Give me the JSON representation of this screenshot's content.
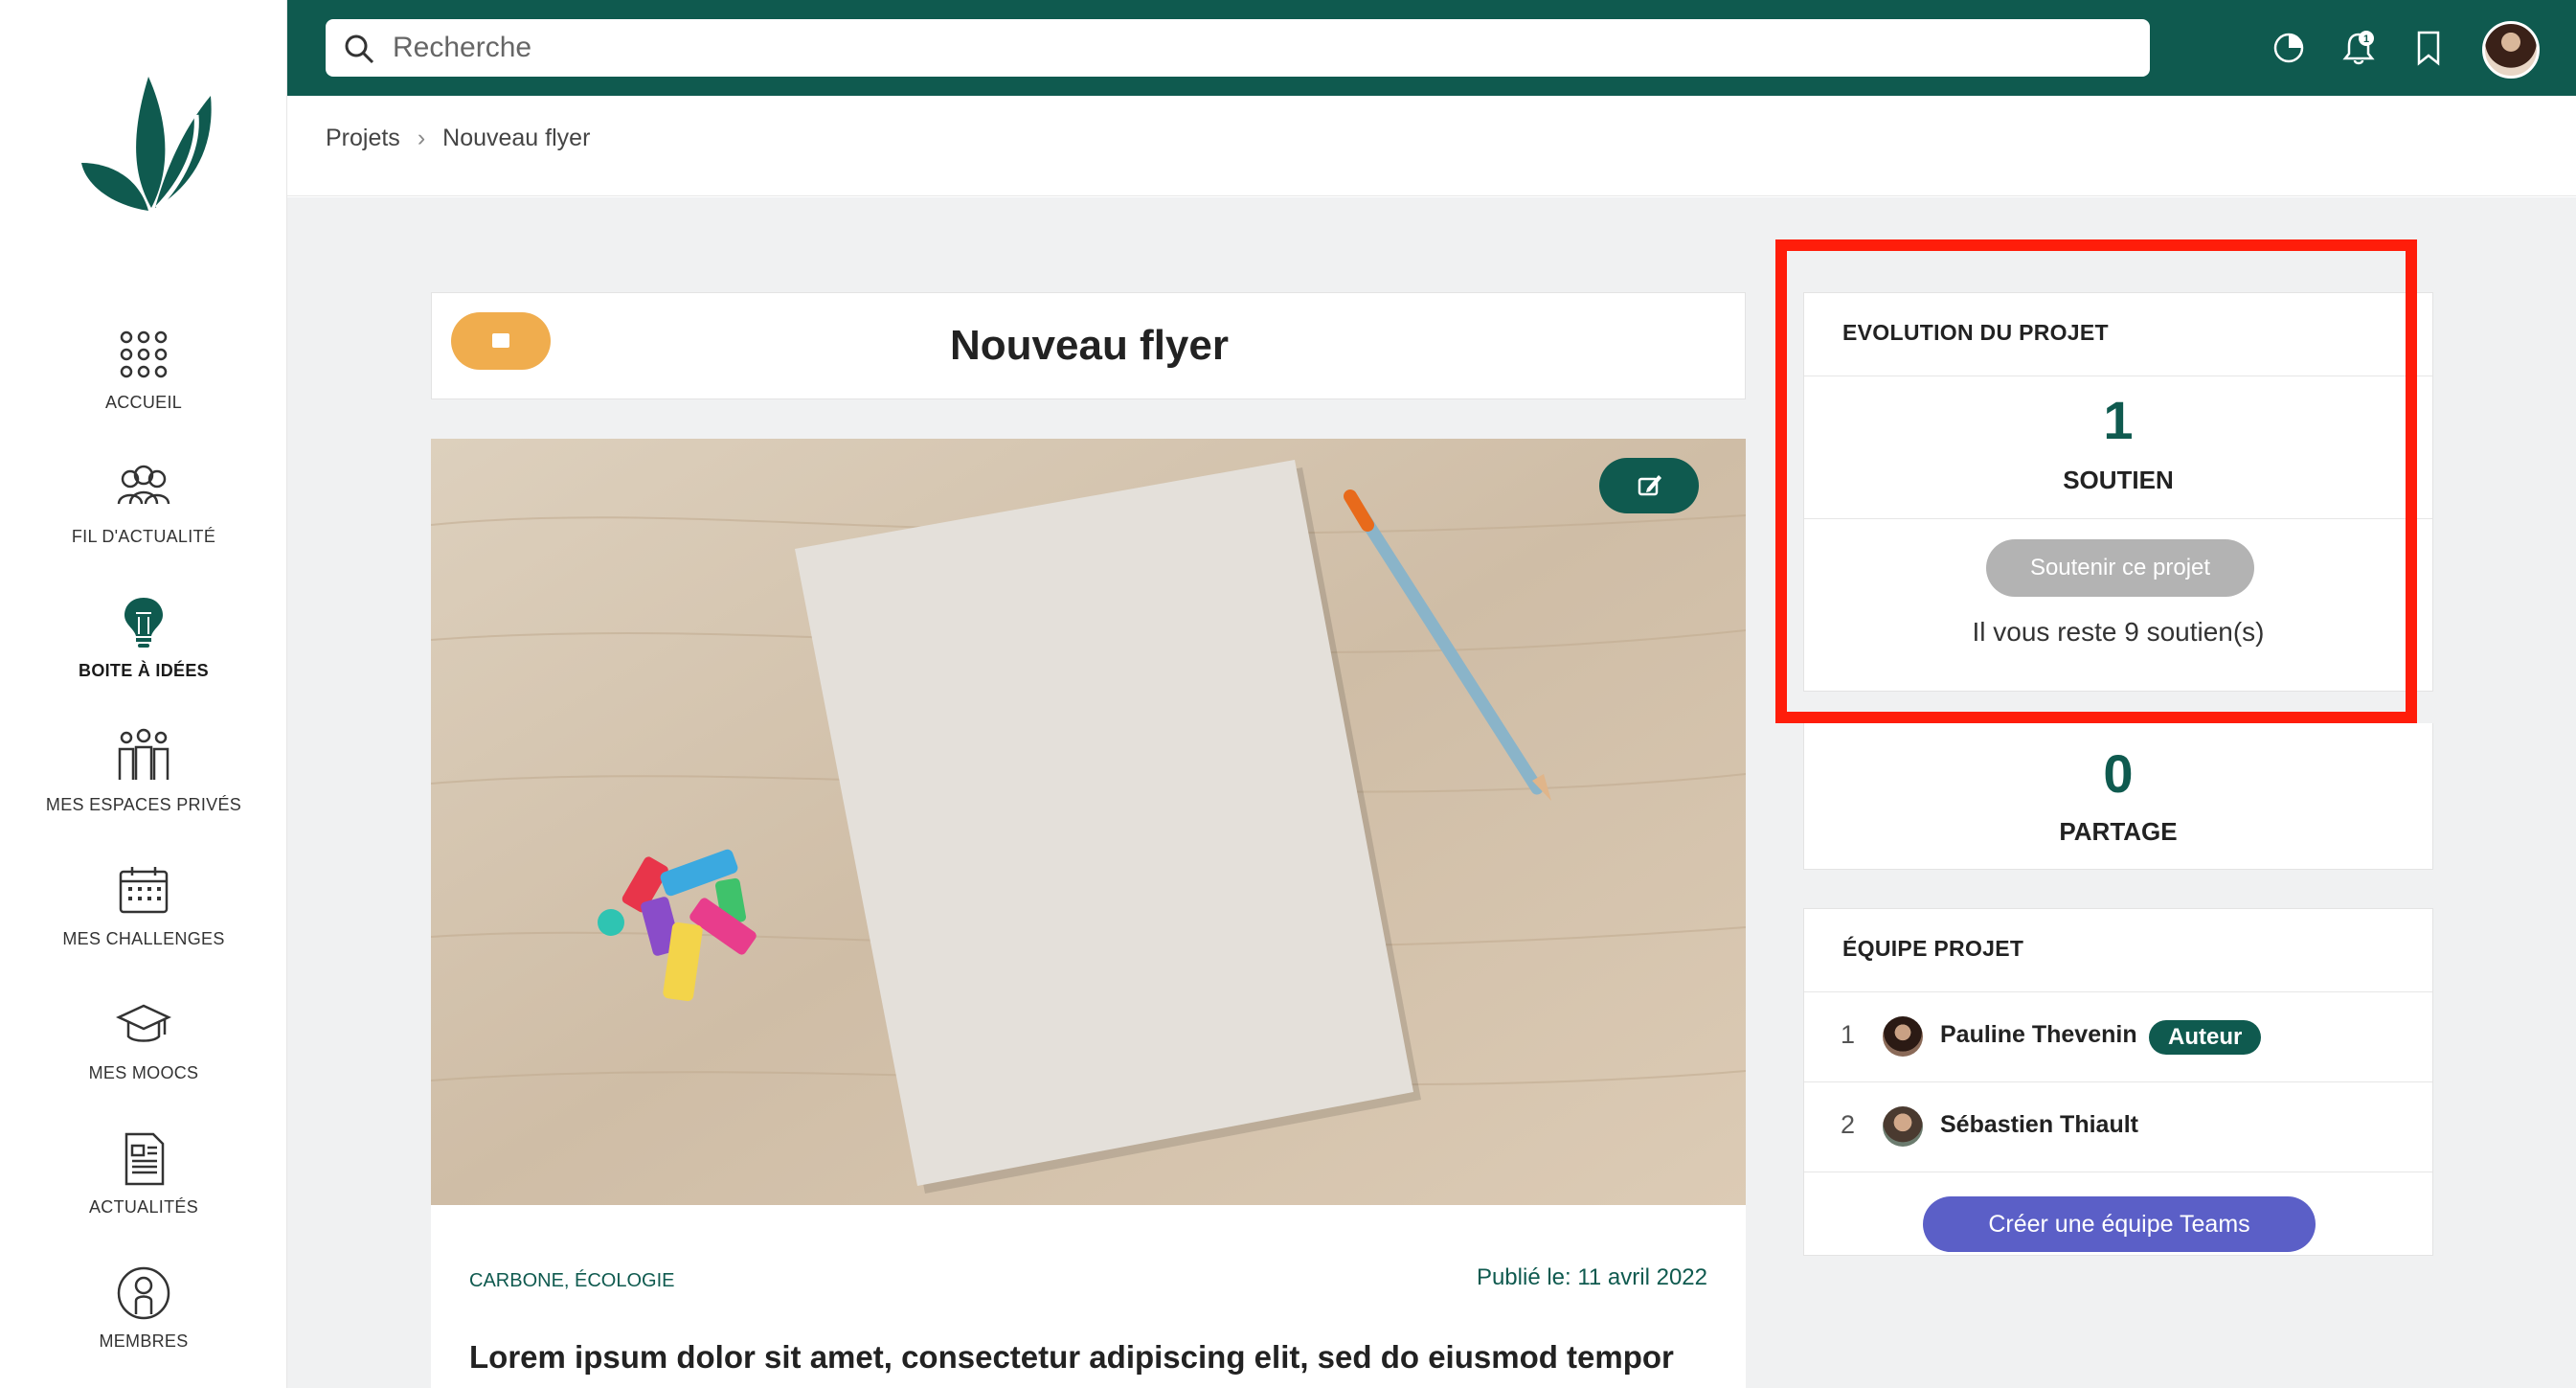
{
  "colors": {
    "brand": "#0f5a4f",
    "accent_orange": "#f0ad4e",
    "teams_purple": "#5b5fc7",
    "highlight_red": "#ff1d0a",
    "disabled_gray": "#b3b3b3"
  },
  "sidebar": {
    "items": [
      {
        "label": "ACCUEIL",
        "icon": "grid-dots-icon"
      },
      {
        "label": "FIL D'ACTUALITÉ",
        "icon": "people-group-icon"
      },
      {
        "label": "BOITE À IDÉES",
        "icon": "lightbulb-icon",
        "active": true
      },
      {
        "label": "MES ESPACES PRIVÉS",
        "icon": "team-icon"
      },
      {
        "label": "MES CHALLENGES",
        "icon": "calendar-icon"
      },
      {
        "label": "MES MOOCS",
        "icon": "graduation-cap-icon"
      },
      {
        "label": "ACTUALITÉS",
        "icon": "newspaper-icon"
      },
      {
        "label": "MEMBRES",
        "icon": "member-icon"
      }
    ]
  },
  "header": {
    "search_placeholder": "Recherche",
    "notification_count": "1"
  },
  "breadcrumb": {
    "items": [
      "Projets",
      "Nouveau flyer"
    ]
  },
  "project": {
    "title": "Nouveau flyer",
    "tags": "CARBONE, ÉCOLOGIE",
    "published": "Publié le: 11 avril 2022",
    "excerpt": "Lorem ipsum dolor sit amet, consectetur adipiscing elit, sed do eiusmod tempor"
  },
  "evolution": {
    "header": "EVOLUTION DU PROJET",
    "support_count": "1",
    "support_label": "SOUTIEN",
    "support_button": "Soutenir ce projet",
    "remaining": "Il vous reste 9 soutien(s)",
    "share_count": "0",
    "share_label": "PARTAGE"
  },
  "team": {
    "header": "ÉQUIPE PROJET",
    "members": [
      {
        "num": "1",
        "name": "Pauline Thevenin",
        "badge": "Auteur"
      },
      {
        "num": "2",
        "name": "Sébastien Thiault"
      }
    ],
    "teams_button": "Créer une équipe Teams"
  }
}
